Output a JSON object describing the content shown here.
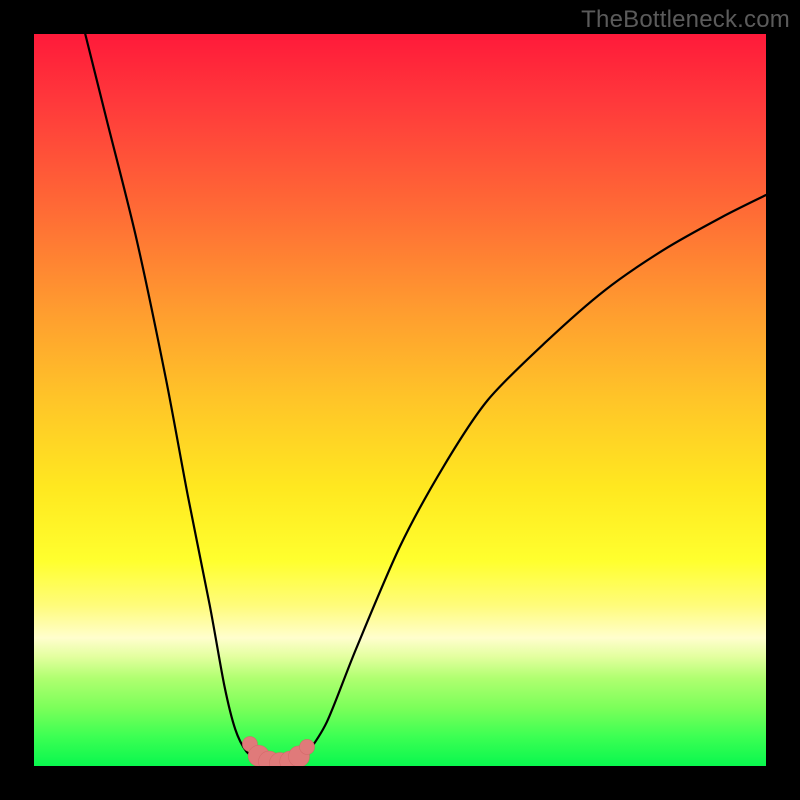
{
  "watermark": {
    "text": "TheBottleneck.com"
  },
  "colors": {
    "frame": "#000000",
    "curve_stroke": "#000000",
    "marker_fill": "#e07a7a",
    "marker_stroke": "#d46a6a"
  },
  "chart_data": {
    "type": "line",
    "title": "",
    "xlabel": "",
    "ylabel": "",
    "xlim": [
      0,
      100
    ],
    "ylim": [
      0,
      100
    ],
    "grid": false,
    "legend": false,
    "series": [
      {
        "name": "left_branch",
        "x": [
          7,
          10,
          14,
          18,
          21,
          24,
          26,
          27.5,
          29,
          30.5
        ],
        "y": [
          100,
          88,
          72,
          53,
          37,
          22,
          11,
          5,
          2,
          1
        ]
      },
      {
        "name": "minimum_segment",
        "x": [
          30.5,
          31.5,
          33,
          34.5,
          36,
          37
        ],
        "y": [
          1,
          0.4,
          0.2,
          0.3,
          0.6,
          1.3
        ]
      },
      {
        "name": "right_branch",
        "x": [
          37,
          40,
          44,
          50,
          56,
          62,
          70,
          78,
          86,
          94,
          100
        ],
        "y": [
          1.3,
          6,
          16,
          30,
          41,
          50,
          58,
          65,
          70.5,
          75,
          78
        ]
      }
    ],
    "markers": {
      "name": "highlight_points",
      "x": [
        29.5,
        30.7,
        32.1,
        33.6,
        35.0,
        36.2,
        37.3
      ],
      "y": [
        3.0,
        1.4,
        0.6,
        0.4,
        0.6,
        1.3,
        2.6
      ]
    },
    "annotations": []
  }
}
